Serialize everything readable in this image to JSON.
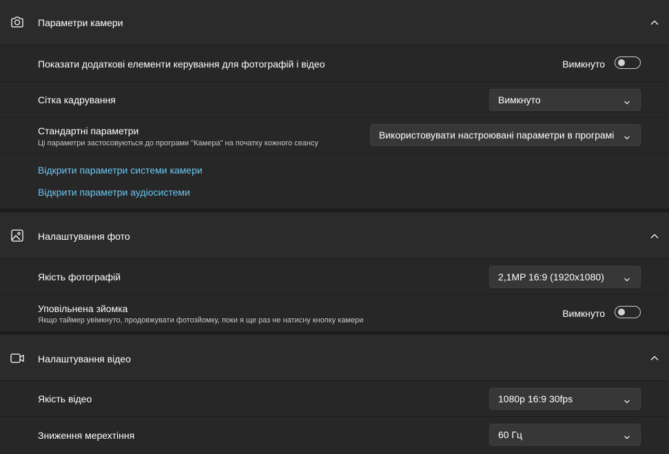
{
  "camera_settings": {
    "title": "Параметри камери",
    "icon": "camera-icon",
    "extra_controls": {
      "label": "Показати додаткові елементи керування для фотографій і відео",
      "state_text": "Вимкнуто",
      "on": false
    },
    "framing_grid": {
      "label": "Сітка кадрування",
      "value": "Вимкнуто"
    },
    "default_settings": {
      "label": "Стандартні параметри",
      "description": "Ці параметри застосовуються до програми \"Камера\" на початку кожного сеансу",
      "value": "Використовувати настроювані параметри в програмі"
    },
    "links": {
      "camera_system": "Відкрити параметри системи камери",
      "audio_system": "Відкрити параметри аудіосистеми"
    }
  },
  "photo_settings": {
    "title": "Налаштування фото",
    "icon": "photo-icon",
    "photo_quality": {
      "label": "Якість фотографій",
      "value": "2,1MP 16:9 (1920x1080)"
    },
    "time_lapse": {
      "label": "Уповільнена зйомка",
      "description": "Якщо таймер увімкнуто, продовжувати фотозйомку, поки я ще раз не натисну кнопку камери",
      "state_text": "Вимкнуто",
      "on": false
    }
  },
  "video_settings": {
    "title": "Налаштування відео",
    "icon": "video-icon",
    "video_quality": {
      "label": "Якість відео",
      "value": "1080p 16:9 30fps"
    },
    "flicker_reduction": {
      "label": "Зниження мерехтіння",
      "value": "60 Гц"
    }
  },
  "colors": {
    "background": "#1c1c1c",
    "section": "#2b2b2b",
    "row": "#272727",
    "dropdown": "#373737",
    "link": "#6ac6f3"
  }
}
